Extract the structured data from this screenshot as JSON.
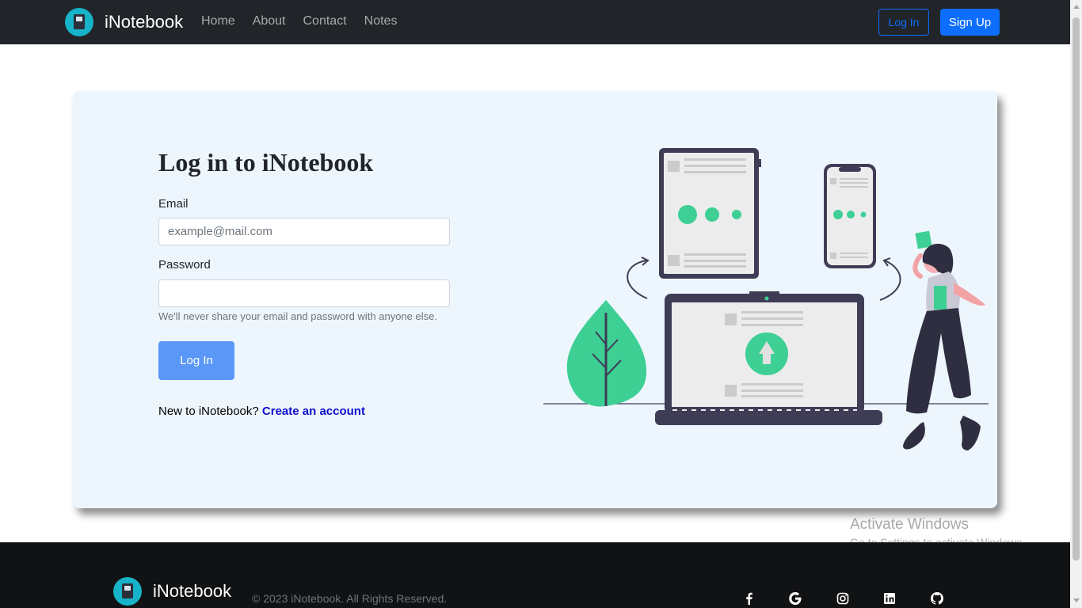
{
  "nav": {
    "brand": "iNotebook",
    "links": [
      "Home",
      "About",
      "Contact",
      "Notes"
    ],
    "login_label": "Log In",
    "signup_label": "Sign Up"
  },
  "form": {
    "title": "Log in to iNotebook",
    "email_label": "Email",
    "email_placeholder": "example@mail.com",
    "password_label": "Password",
    "help_text": "We'll never share your email and password with anyone else.",
    "login_button": "Log In",
    "new_to_text": "New to iNotebook?",
    "create_account_link": "Create an account"
  },
  "footer": {
    "brand": "iNotebook",
    "copyright": "© 2023 iNotebook. All Rights Reserved.",
    "social_icons": [
      "facebook-icon",
      "google-icon",
      "instagram-icon",
      "linkedin-icon",
      "github-icon"
    ]
  },
  "watermark": {
    "title": "Activate Windows",
    "subtitle": "Go to Settings to activate Windows."
  },
  "colors": {
    "navbar_bg": "#212529",
    "primary": "#0d6efd",
    "card_bg": "#eef6fd",
    "accent_green": "#3ecf95",
    "footer_bg": "#111214"
  }
}
